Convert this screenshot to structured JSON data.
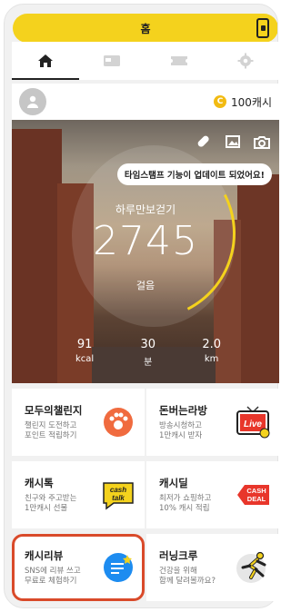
{
  "header": {
    "title": "홈"
  },
  "profile": {
    "coins": "100캐시",
    "coin_symbol": "C"
  },
  "banner": {
    "text": "타임스탬프 기능이 업데이트 되었어요!"
  },
  "walk": {
    "label": "하루만보걷기",
    "steps": "2745",
    "unit": "걸음",
    "stats": [
      {
        "value": "91",
        "unit": "kcal"
      },
      {
        "value": "30",
        "unit": "분"
      },
      {
        "value": "2.0",
        "unit": "km"
      }
    ]
  },
  "cards": [
    {
      "title": "모두의챌린지",
      "desc1": "챌린지 도전하고",
      "desc2": "포인트 적립하기"
    },
    {
      "title": "돈버는라방",
      "desc1": "방송시청하고",
      "desc2": "1만캐시 받자",
      "icon_text": "Live"
    },
    {
      "title": "캐시톡",
      "desc1": "친구와 주고받는",
      "desc2": "1만캐시 선물",
      "icon_text1": "cash",
      "icon_text2": "talk"
    },
    {
      "title": "캐시딜",
      "desc1": "최저가 쇼핑하고",
      "desc2": "10% 캐시 적립",
      "icon_text1": "CASH",
      "icon_text2": "DEAL"
    },
    {
      "title": "캐시리뷰",
      "desc1": "SNS에 리뷰 쓰고",
      "desc2": "무료로 체험하기"
    },
    {
      "title": "러닝크루",
      "desc1": "건강을 위해",
      "desc2": "함께 달려볼까요?"
    }
  ],
  "colors": {
    "accent": "#f4d21d",
    "highlight": "#d94a2a",
    "brand_red": "#e8362b",
    "brand_blue": "#1d8cf0"
  }
}
